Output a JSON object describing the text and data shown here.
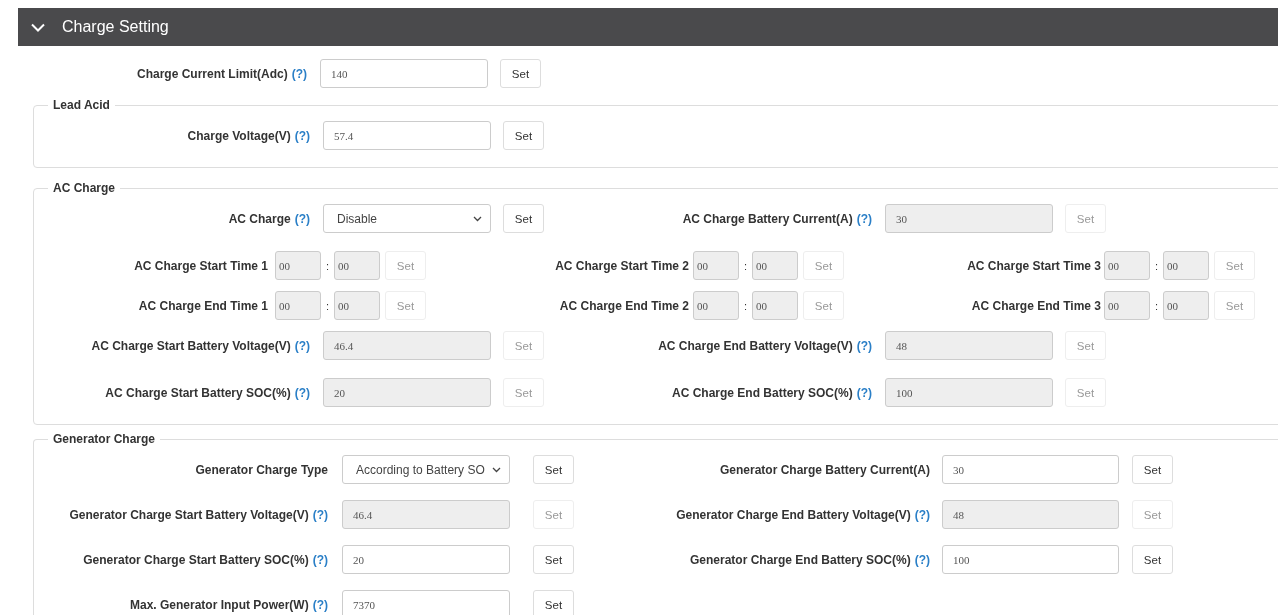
{
  "header": {
    "title": "Charge Setting",
    "expanded": true
  },
  "sections": [
    {
      "kind": "plain",
      "rows": [
        {
          "kind": "pair",
          "fields": [
            {
              "kind": "input",
              "label": "Charge Current Limit(Adc)",
              "help": "(?)",
              "value": "140",
              "disabled": false,
              "button": "Set"
            }
          ]
        }
      ]
    },
    {
      "kind": "fieldset",
      "legend": "Lead Acid",
      "rows": [
        {
          "kind": "pair",
          "fields": [
            {
              "kind": "input",
              "label": "Charge Voltage(V)",
              "help": "(?)",
              "value": "57.4",
              "disabled": false,
              "button": "Set"
            }
          ]
        }
      ]
    },
    {
      "kind": "fieldset",
      "legend": "AC Charge",
      "rows": [
        {
          "kind": "pair",
          "fields": [
            {
              "kind": "select",
              "label": "AC Charge",
              "help": "(?)",
              "value": "Disable",
              "disabled": false,
              "button": "Set"
            },
            {
              "kind": "input",
              "label": "AC Charge Battery Current(A)",
              "help": "(?)",
              "value": "30",
              "disabled": true,
              "button": "Set"
            }
          ]
        },
        {
          "kind": "times",
          "fields": [
            {
              "kind": "time",
              "label": "AC Charge Start Time 1",
              "hour": "00",
              "separator": ":",
              "minute": "00",
              "disabled": true,
              "button": "Set"
            },
            {
              "kind": "time",
              "label": "AC Charge Start Time 2",
              "hour": "00",
              "separator": ":",
              "minute": "00",
              "disabled": true,
              "button": "Set"
            },
            {
              "kind": "time",
              "label": "AC Charge Start Time 3",
              "hour": "00",
              "separator": ":",
              "minute": "00",
              "disabled": true,
              "button": "Set"
            }
          ]
        },
        {
          "kind": "times",
          "fields": [
            {
              "kind": "time",
              "label": "AC Charge End Time 1",
              "hour": "00",
              "separator": ":",
              "minute": "00",
              "disabled": true,
              "button": "Set"
            },
            {
              "kind": "time",
              "label": "AC Charge End Time 2",
              "hour": "00",
              "separator": ":",
              "minute": "00",
              "disabled": true,
              "button": "Set"
            },
            {
              "kind": "time",
              "label": "AC Charge End Time 3",
              "hour": "00",
              "separator": ":",
              "minute": "00",
              "disabled": true,
              "button": "Set"
            }
          ]
        },
        {
          "kind": "pair",
          "fields": [
            {
              "kind": "input",
              "label": "AC Charge Start Battery Voltage(V)",
              "help": "(?)",
              "value": "46.4",
              "disabled": true,
              "button": "Set"
            },
            {
              "kind": "input",
              "label": "AC Charge End Battery Voltage(V)",
              "help": "(?)",
              "value": "48",
              "disabled": true,
              "button": "Set"
            }
          ]
        },
        {
          "kind": "pair",
          "fields": [
            {
              "kind": "input",
              "label": "AC Charge Start Battery SOC(%)",
              "help": "(?)",
              "value": "20",
              "disabled": true,
              "button": "Set"
            },
            {
              "kind": "input",
              "label": "AC Charge End Battery SOC(%)",
              "help": "(?)",
              "value": "100",
              "disabled": true,
              "button": "Set"
            }
          ]
        }
      ]
    },
    {
      "kind": "fieldset",
      "legend": "Generator Charge",
      "rows": [
        {
          "kind": "pair",
          "fields": [
            {
              "kind": "select",
              "label": "Generator Charge Type",
              "value": "According to Battery SO",
              "disabled": false,
              "button": "Set"
            },
            {
              "kind": "input",
              "label": "Generator Charge Battery Current(A)",
              "value": "30",
              "disabled": false,
              "button": "Set"
            }
          ]
        },
        {
          "kind": "pair",
          "fields": [
            {
              "kind": "input",
              "label": "Generator Charge Start Battery Voltage(V)",
              "help": "(?)",
              "value": "46.4",
              "disabled": true,
              "button": "Set"
            },
            {
              "kind": "input",
              "label": "Generator Charge End Battery Voltage(V)",
              "help": "(?)",
              "value": "48",
              "disabled": true,
              "button": "Set"
            }
          ]
        },
        {
          "kind": "pair",
          "fields": [
            {
              "kind": "input",
              "label": "Generator Charge Start Battery SOC(%)",
              "help": "(?)",
              "value": "20",
              "disabled": false,
              "button": "Set"
            },
            {
              "kind": "input",
              "label": "Generator Charge End Battery SOC(%)",
              "help": "(?)",
              "value": "100",
              "disabled": false,
              "button": "Set"
            }
          ]
        },
        {
          "kind": "pair",
          "fields": [
            {
              "kind": "input",
              "label": "Max. Generator Input Power(W)",
              "help": "(?)",
              "value": "7370",
              "disabled": false,
              "button": "Set"
            }
          ]
        }
      ]
    }
  ]
}
